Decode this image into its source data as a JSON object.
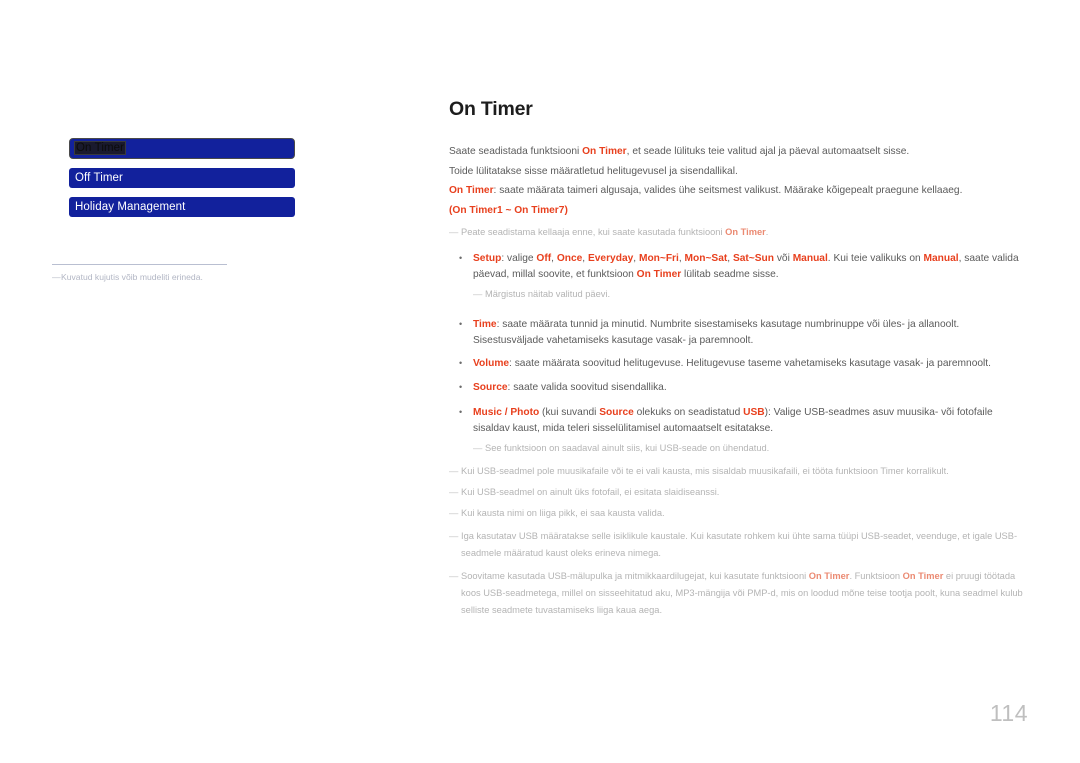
{
  "document": {
    "page_number": "114"
  },
  "sidebar": {
    "items": [
      {
        "label": "On Timer",
        "selected": true
      },
      {
        "label": "Off Timer",
        "selected": false
      },
      {
        "label": "Holiday Management",
        "selected": false
      }
    ],
    "note": {
      "dash": "―",
      "text": "Kuvatud kujutis võib mudeliti erineda."
    }
  },
  "main": {
    "title": "On Timer",
    "intro_1": {
      "a": "Saate seadistada funktsiooni ",
      "kw": "On Timer",
      "b": ", et seade lülituks teie valitud ajal ja päeval automaatselt sisse."
    },
    "intro_2": "Toide lülitatakse sisse määratletud helitugevusel ja sisendallikal.",
    "on_timer_desc": {
      "kw": "On Timer",
      "text": ": saate määrata taimeri algusaja, valides ühe seitsmest valikust. Määrake kõigepealt praegune kellaaeg."
    },
    "range_line": {
      "open": "(",
      "from": "On Timer1",
      "sep": " ~ ",
      "to": "On Timer7",
      "close": ")"
    },
    "note_clock": {
      "dash": "―",
      "a": "Peate seadistama kellaaja enne, kui saate kasutada funktsiooni ",
      "kw": "On Timer",
      "b": "."
    },
    "bullets": [
      {
        "marker": "•",
        "name": "setup",
        "segments": [
          {
            "t": "Setup",
            "s": "red"
          },
          {
            "t": ": valige ",
            "s": "plain"
          },
          {
            "t": "Off",
            "s": "red"
          },
          {
            "t": ", ",
            "s": "plain"
          },
          {
            "t": "Once",
            "s": "red"
          },
          {
            "t": ", ",
            "s": "plain"
          },
          {
            "t": "Everyday",
            "s": "red"
          },
          {
            "t": ", ",
            "s": "plain"
          },
          {
            "t": "Mon~Fri",
            "s": "red"
          },
          {
            "t": ", ",
            "s": "plain"
          },
          {
            "t": "Mon~Sat",
            "s": "red"
          },
          {
            "t": ", ",
            "s": "plain"
          },
          {
            "t": "Sat~Sun",
            "s": "red"
          },
          {
            "t": " või ",
            "s": "plain"
          },
          {
            "t": "Manual",
            "s": "red"
          },
          {
            "t": ". Kui teie valikuks on ",
            "s": "plain"
          },
          {
            "t": "Manual",
            "s": "red"
          },
          {
            "t": ", saate valida päevad, millal soovite, et funktsioon ",
            "s": "plain"
          },
          {
            "t": "On Timer",
            "s": "red"
          },
          {
            "t": " lülitab seadme sisse.",
            "s": "plain"
          }
        ],
        "note": {
          "dash": "―",
          "text": "Märgistus näitab valitud päevi."
        }
      },
      {
        "marker": "•",
        "name": "time",
        "segments": [
          {
            "t": "Time",
            "s": "red"
          },
          {
            "t": ": saate määrata tunnid ja minutid. Numbrite sisestamiseks kasutage numbrinuppe või üles- ja allanoolt. Sisestusväljade vahetamiseks kasutage vasak- ja paremnoolt.",
            "s": "plain"
          }
        ],
        "note": null
      },
      {
        "marker": "•",
        "name": "volume",
        "segments": [
          {
            "t": "Volume",
            "s": "red"
          },
          {
            "t": ": saate määrata soovitud helitugevuse. Helitugevuse taseme vahetamiseks kasutage vasak- ja paremnoolt.",
            "s": "plain"
          }
        ],
        "note": null
      },
      {
        "marker": "•",
        "name": "source",
        "segments": [
          {
            "t": "Source",
            "s": "red"
          },
          {
            "t": ": saate valida soovitud sisendallika.",
            "s": "plain"
          }
        ],
        "note": null
      },
      {
        "marker": "•",
        "name": "music-photo",
        "segments": [
          {
            "t": "Music / Photo",
            "s": "red"
          },
          {
            "t": " (kui suvandi ",
            "s": "plain"
          },
          {
            "t": "Source",
            "s": "red"
          },
          {
            "t": " olekuks on seadistatud ",
            "s": "plain"
          },
          {
            "t": "USB",
            "s": "red"
          },
          {
            "t": "): Valige USB-seadmes asuv muusika- või fotofaile sisaldav kaust, mida teleri sisselülitamisel automaatselt esitatakse.",
            "s": "plain"
          }
        ],
        "note": {
          "dash": "―",
          "text": "See funktsioon on saadaval ainult siis, kui USB-seade on ühendatud."
        }
      }
    ],
    "footer_notes": [
      {
        "dash": "―",
        "text": "Kui USB-seadmel pole muusikafaile või te ei vali kausta, mis sisaldab muusikafaili, ei tööta funktsioon Timer korralikult."
      },
      {
        "dash": "―",
        "text": "Kui USB-seadmel on ainult üks fotofail, ei esitata slaidiseanssi."
      },
      {
        "dash": "―",
        "text": "Kui kausta nimi on liiga pikk, ei saa kausta valida."
      },
      {
        "dash": "―",
        "text": "Iga kasutatav USB määratakse selle isiklikule kaustale. Kui kasutate rohkem kui ühte sama tüüpi USB-seadet, veenduge, et igale USB-seadmele määratud kaust oleks erineva nimega."
      }
    ],
    "final_note": {
      "dash": "―",
      "a": "Soovitame kasutada USB-mälupulka ja mitmikkaardilugejat, kui kasutate funktsiooni ",
      "kw1": "On Timer",
      "b": ". Funktsioon ",
      "kw2": "On Timer",
      "c": " ei pruugi töötada koos USB-seadmetega, millel on sisseehitatud aku, MP3-mängija või PMP-d, mis on loodud mõne teise tootja poolt, kuna seadmel kulub selliste seadmete tuvastamiseks liiga kaua aega."
    }
  },
  "colors": {
    "accent_red": "#e8401e",
    "menu_blue": "#12219c",
    "body_gray": "#5b5b5b",
    "note_gray": "#b4b4b4"
  }
}
